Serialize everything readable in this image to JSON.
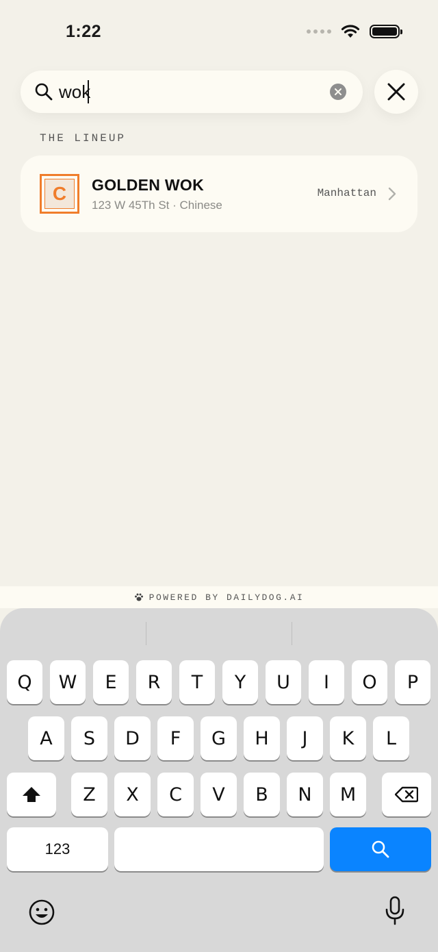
{
  "status": {
    "time": "1:22"
  },
  "search": {
    "query": "wok",
    "placeholder": ""
  },
  "section_title": "THE LINEUP",
  "result": {
    "logo_letter": "C",
    "name": "GOLDEN WOK",
    "subtitle": "123 W 45Th St · Chinese",
    "borough": "Manhattan"
  },
  "powered_by": "POWERED BY DAILYDOG.AI",
  "keyboard": {
    "row1": [
      "Q",
      "W",
      "E",
      "R",
      "T",
      "Y",
      "U",
      "I",
      "O",
      "P"
    ],
    "row2": [
      "A",
      "S",
      "D",
      "F",
      "G",
      "H",
      "J",
      "K",
      "L"
    ],
    "row3": [
      "Z",
      "X",
      "C",
      "V",
      "B",
      "N",
      "M"
    ],
    "numbers_label": "123"
  },
  "colors": {
    "accent": "#f07d2b",
    "background": "#f3f1e9",
    "card": "#fdfbf3",
    "keyboard_action": "#0a84ff"
  },
  "icons": [
    "search-icon",
    "clear-icon",
    "close-icon",
    "chevron-right-icon",
    "paw-icon",
    "shift-icon",
    "backspace-icon",
    "emoji-icon",
    "microphone-icon",
    "wifi-icon",
    "battery-icon"
  ]
}
